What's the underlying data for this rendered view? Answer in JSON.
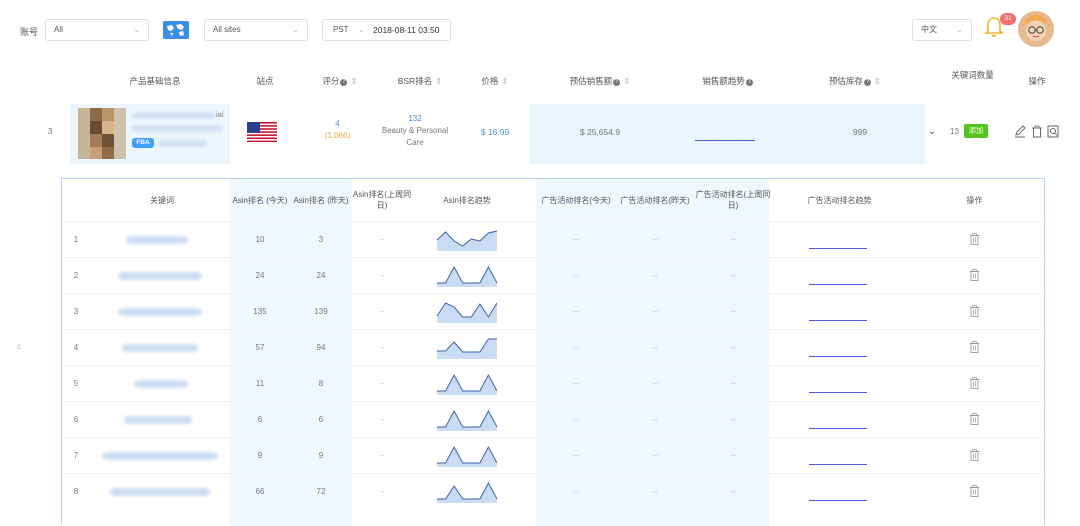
{
  "topbar": {
    "account_label": "账号",
    "account_value": "All",
    "site_value": "All sites",
    "timezone": "PST",
    "datetime": "2018-08-11 03:50",
    "language": "中文",
    "notification_count": "31"
  },
  "main_table": {
    "headers": {
      "product_info": "产品基础信息",
      "site": "站点",
      "rating": "评分",
      "bsr": "BSR排名",
      "price": "价格",
      "est_sales": "预估销售额",
      "sales_trend": "销售额趋势",
      "est_stock": "预估库存",
      "keyword_count": "关键词数量",
      "actions": "操作"
    },
    "row": {
      "index": "3",
      "product_suffix": "ial",
      "fba_label": "FBA",
      "rating": "4",
      "rating_count": "(1,066)",
      "bsr_rank": "132",
      "bsr_category": "Beauty & Personal Care",
      "price": "$ 16.99",
      "est_sales": "$ 25,654.9",
      "est_stock": "999",
      "keyword_count": "13",
      "add_label": "添加"
    }
  },
  "sub_table": {
    "headers": {
      "keyword": "关键词",
      "asin_today": "Asin排名 (今天)",
      "asin_yesterday": "Asin排名 (昨天)",
      "asin_lastweek": "Asin排名(上周同日)",
      "asin_trend": "Asin排名趋势",
      "ad_today": "广告活动排名(今天)",
      "ad_yesterday": "广告活动排名(昨天)",
      "ad_lastweek": "广告活动排名(上周同日)",
      "ad_trend": "广告活动排名趋势",
      "actions": "操作"
    },
    "rows": [
      {
        "index": "1",
        "today": "10",
        "yesterday": "3",
        "lastweek": "--",
        "ad_today": "--",
        "ad_yesterday": "--",
        "ad_lastweek": "--",
        "spark": [
          0.55,
          0.15,
          0.6,
          0.85,
          0.5,
          0.6,
          0.2,
          0.1
        ]
      },
      {
        "index": "2",
        "today": "24",
        "yesterday": "24",
        "lastweek": "--",
        "ad_today": "--",
        "ad_yesterday": "--",
        "ad_lastweek": "--",
        "spark": [
          0.9,
          0.9,
          0.1,
          0.9,
          0.9,
          0.9,
          0.1,
          0.9
        ]
      },
      {
        "index": "3",
        "today": "135",
        "yesterday": "139",
        "lastweek": "--",
        "ad_today": "--",
        "ad_yesterday": "--",
        "ad_lastweek": "--",
        "spark": [
          0.75,
          0.1,
          0.3,
          0.8,
          0.8,
          0.15,
          0.8,
          0.1
        ]
      },
      {
        "index": "4",
        "today": "57",
        "yesterday": "94",
        "lastweek": "--",
        "ad_today": "--",
        "ad_yesterday": "--",
        "ad_lastweek": "--",
        "spark": [
          0.7,
          0.7,
          0.25,
          0.75,
          0.75,
          0.75,
          0.1,
          0.1
        ]
      },
      {
        "index": "5",
        "today": "11",
        "yesterday": "8",
        "lastweek": "--",
        "ad_today": "--",
        "ad_yesterday": "--",
        "ad_lastweek": "--",
        "spark": [
          0.9,
          0.9,
          0.1,
          0.9,
          0.9,
          0.9,
          0.1,
          0.9
        ]
      },
      {
        "index": "6",
        "today": "6",
        "yesterday": "6",
        "lastweek": "--",
        "ad_today": "--",
        "ad_yesterday": "--",
        "ad_lastweek": "--",
        "spark": [
          0.9,
          0.9,
          0.1,
          0.9,
          0.9,
          0.9,
          0.1,
          0.9
        ]
      },
      {
        "index": "7",
        "today": "9",
        "yesterday": "9",
        "lastweek": "--",
        "ad_today": "--",
        "ad_yesterday": "--",
        "ad_lastweek": "--",
        "spark": [
          0.9,
          0.9,
          0.1,
          0.9,
          0.9,
          0.9,
          0.1,
          0.9
        ]
      },
      {
        "index": "8",
        "today": "66",
        "yesterday": "72",
        "lastweek": "--",
        "ad_today": "--",
        "ad_yesterday": "--",
        "ad_lastweek": "--",
        "spark": [
          0.9,
          0.9,
          0.25,
          0.9,
          0.9,
          0.9,
          0.1,
          0.9
        ]
      }
    ]
  },
  "side_mark": "c",
  "colors": {
    "accent": "#4a90d9",
    "highlight": "#eaf4fd",
    "add_button": "#52c41a",
    "badge": "#f56c6c",
    "fba": "#409eff",
    "rating_count": "#e6a23c"
  }
}
